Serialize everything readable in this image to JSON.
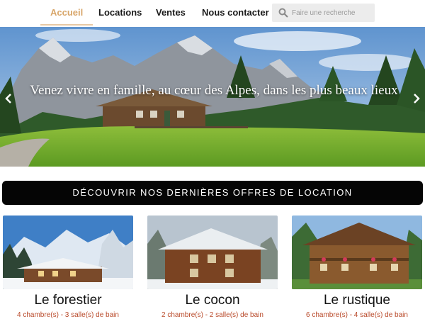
{
  "nav": {
    "items": [
      {
        "label": "Accueil",
        "active": true
      },
      {
        "label": "Locations"
      },
      {
        "label": "Ventes"
      },
      {
        "label": "Nous contacter"
      }
    ],
    "search_placeholder": "Faire une recherche"
  },
  "hero": {
    "text": "Venez vivre en famille, au cœur des Alpes, dans les plus beaux lieux"
  },
  "cta": {
    "label": "DÉCOUVRIR NOS DERNIÈRES OFFRES DE LOCATION"
  },
  "cards": [
    {
      "title": "Le forestier",
      "details": "4 chambre(s) - 3 salle(s) de bain"
    },
    {
      "title": "Le cocon",
      "details": "2 chambre(s) - 2 salle(s) de bain"
    },
    {
      "title": "Le rustique",
      "details": "6 chambre(s) - 4 salle(s) de bain"
    }
  ],
  "colors": {
    "accent": "#d8a66a",
    "cta_bg": "#050505",
    "detail_text": "#b94a2a"
  }
}
